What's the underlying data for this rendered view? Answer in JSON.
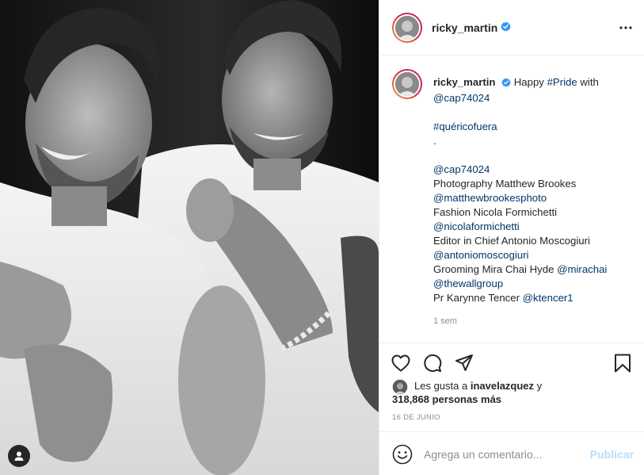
{
  "post": {
    "author": "ricky_martin",
    "verified": true,
    "caption": {
      "author": "ricky_martin",
      "intro": "Happy",
      "hashtag_pride": "#Pride",
      "with": "with",
      "mention_cap1": "@cap74024",
      "hashtag_quericofuera": "#quéricofuera",
      "dot": ".",
      "mention_cap2": "@cap74024",
      "photography": "Photography Matthew Brookes",
      "mention_photo": "@matthewbrookesphoto",
      "fashion": "Fashion Nicola Formichetti",
      "mention_fashion": "@nicolaformichetti",
      "editor": "Editor in Chief Antonio Moscogiuri",
      "mention_editor": "@antoniomoscogiuri",
      "grooming": "Grooming Mira Chai Hyde",
      "mention_grooming": "@mirachai",
      "mention_wallgroup": "@thewallgroup",
      "pr": "Pr Karynne Tencer",
      "mention_pr": "@ktencer1",
      "time_ago": "1 sem"
    },
    "likes": {
      "prefix": "Les gusta a",
      "liker": "inavelazquez",
      "and": "y",
      "count_text": "318,868 personas más"
    },
    "date": "16 DE JUNIO"
  },
  "comment": {
    "placeholder": "Agrega un comentario...",
    "publish_label": "Publicar"
  },
  "icons": {
    "like": "heart-icon",
    "comment": "comment-icon",
    "share": "paper-plane-icon",
    "save": "bookmark-icon",
    "more": "more-horizontal-icon",
    "emoji": "emoji-icon",
    "user_tags": "user-tag-icon",
    "verified": "verified-badge-icon"
  },
  "colors": {
    "link": "#00376b",
    "verified": "#3897f0",
    "publish_disabled": "#b2dffc",
    "secondary_text": "#8e8e8e"
  }
}
